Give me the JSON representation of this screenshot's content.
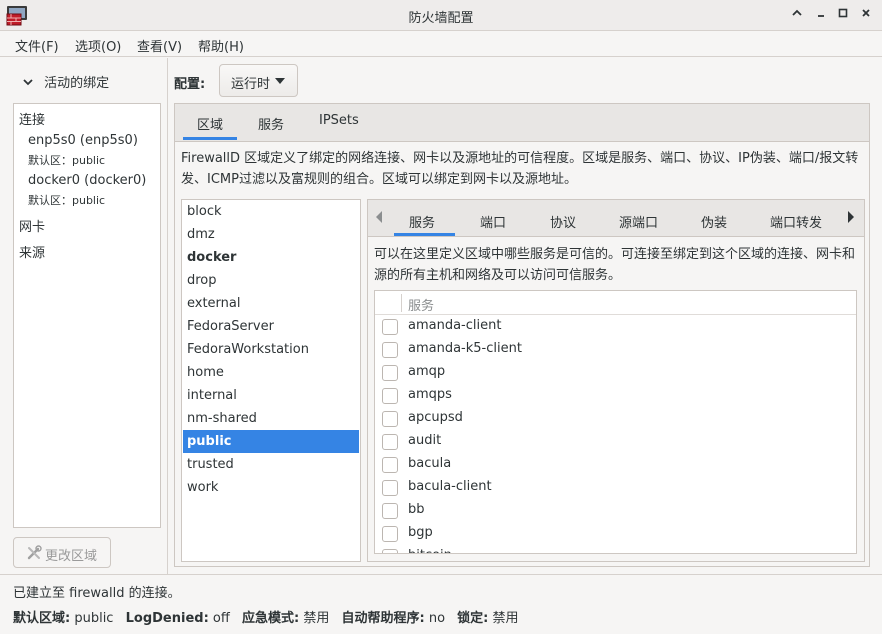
{
  "window": {
    "title": "防火墙配置",
    "controls": {
      "collapse": "^",
      "minimize": "–",
      "maximize": "□",
      "close": "×"
    }
  },
  "menubar": [
    "文件(F)",
    "选项(O)",
    "查看(V)",
    "帮助(H)"
  ],
  "sidebar": {
    "header": "活动的绑定",
    "connections_label": "连接",
    "connections": [
      {
        "name": "enp5s0 (enp5s0)",
        "zone": "默认区：public"
      },
      {
        "name": "docker0 (docker0)",
        "zone": "默认区：public"
      }
    ],
    "nic_label": "网卡",
    "source_label": "来源",
    "change_zone_button": "更改区域"
  },
  "config": {
    "label": "配置:",
    "value": "运行时"
  },
  "main_tabs": [
    {
      "label": "区域",
      "active": true
    },
    {
      "label": "服务",
      "active": false
    },
    {
      "label": "IPSets",
      "active": false
    }
  ],
  "zone_description": "FirewallD 区域定义了绑定的网络连接、网卡以及源地址的可信程度。区域是服务、端口、协议、IP伪装、端口/报文转发、ICMP过滤以及富规则的组合。区域可以绑定到网卡以及源地址。",
  "zones": [
    {
      "name": "block"
    },
    {
      "name": "dmz"
    },
    {
      "name": "docker",
      "bold": true
    },
    {
      "name": "drop"
    },
    {
      "name": "external"
    },
    {
      "name": "FedoraServer"
    },
    {
      "name": "FedoraWorkstation"
    },
    {
      "name": "home"
    },
    {
      "name": "internal"
    },
    {
      "name": "nm-shared"
    },
    {
      "name": "public",
      "selected": true
    },
    {
      "name": "trusted"
    },
    {
      "name": "work"
    }
  ],
  "inner_tabs": [
    {
      "label": "服务",
      "active": true
    },
    {
      "label": "端口"
    },
    {
      "label": "协议"
    },
    {
      "label": "源端口"
    },
    {
      "label": "伪装"
    },
    {
      "label": "端口转发"
    }
  ],
  "services_description": "可以在这里定义区域中哪些服务是可信的。可连接至绑定到这个区域的连接、网卡和源的所有主机和网络及可以访问可信服务。",
  "services_table": {
    "header": "服务",
    "rows": [
      "amanda-client",
      "amanda-k5-client",
      "amqp",
      "amqps",
      "apcupsd",
      "audit",
      "bacula",
      "bacula-client",
      "bb",
      "bgp",
      "bitcoin"
    ]
  },
  "status": {
    "connection": "已建立至 firewalld 的连接。",
    "default_zone_label": "默认区域:",
    "default_zone": "public",
    "log_denied_label": "LogDenied:",
    "log_denied": "off",
    "panic_label": "应急模式:",
    "panic": "禁用",
    "helper_label": "自动帮助程序:",
    "helper": "no",
    "lockdown_label": "锁定:",
    "lockdown": "禁用"
  },
  "colors": {
    "accent": "#3584e4",
    "background": "#f6f5f4"
  }
}
